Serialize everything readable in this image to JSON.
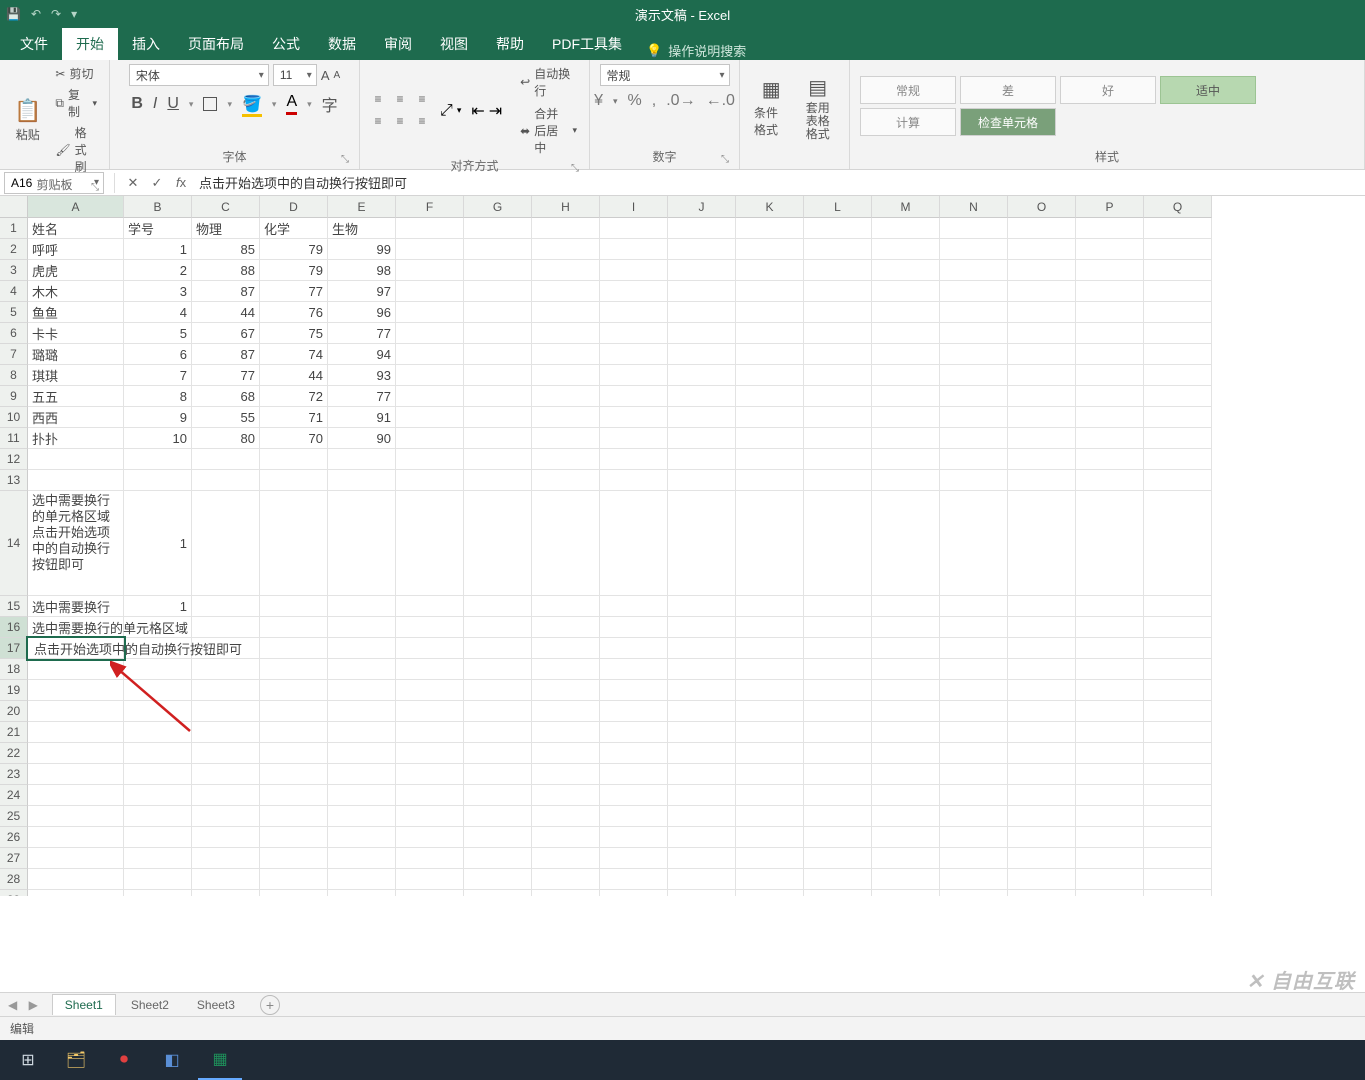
{
  "title": "演示文稿 - Excel",
  "qat": {
    "save": "💾",
    "undo": "↶",
    "redo": "↷",
    "more": "▾"
  },
  "tabs": [
    "文件",
    "开始",
    "插入",
    "页面布局",
    "公式",
    "数据",
    "审阅",
    "视图",
    "帮助",
    "PDF工具集"
  ],
  "active_tab": 1,
  "tell_me": "操作说明搜索",
  "clipboard": {
    "cut": "剪切",
    "copy": "复制",
    "brush": "格式刷",
    "paste": "粘贴",
    "label": "剪贴板"
  },
  "font": {
    "name": "宋体",
    "size": "11",
    "label": "字体",
    "bold": "B",
    "italic": "I",
    "underline": "U"
  },
  "align": {
    "wrap": "自动换行",
    "merge": "合并后居中",
    "label": "对齐方式"
  },
  "number": {
    "general": "常规",
    "label": "数字"
  },
  "cond": {
    "cond": "条件格式",
    "table": "套用\n表格格式"
  },
  "styles": {
    "label": "样式",
    "s1": "常规",
    "s2": "差",
    "s3": "好",
    "s4": "适中",
    "s5": "计算",
    "s6": "检查单元格"
  },
  "namebox": "A16",
  "formula": "点击开始选项中的自动换行按钮即可",
  "editing_value": "点击开始选项中的自动换行按钮即可",
  "cols": [
    "A",
    "B",
    "C",
    "D",
    "E",
    "F",
    "G",
    "H",
    "I",
    "J",
    "K",
    "L",
    "M",
    "N",
    "O",
    "P",
    "Q"
  ],
  "rows": {
    "header": [
      "姓名",
      "学号",
      "物理",
      "化学",
      "生物"
    ],
    "data": [
      [
        "呼呼",
        "1",
        "85",
        "79",
        "99"
      ],
      [
        "虎虎",
        "2",
        "88",
        "79",
        "98"
      ],
      [
        "木木",
        "3",
        "87",
        "77",
        "97"
      ],
      [
        "鱼鱼",
        "4",
        "44",
        "76",
        "96"
      ],
      [
        "卡卡",
        "5",
        "67",
        "75",
        "77"
      ],
      [
        "璐璐",
        "6",
        "87",
        "74",
        "94"
      ],
      [
        "琪琪",
        "7",
        "77",
        "44",
        "93"
      ],
      [
        "五五",
        "8",
        "68",
        "72",
        "77"
      ],
      [
        "西西",
        "9",
        "55",
        "71",
        "91"
      ],
      [
        "扑扑",
        "10",
        "80",
        "70",
        "90"
      ]
    ],
    "r14_a": "选中需要换行的单元格区域 点击开始选项中的自动换行按钮即可",
    "r14_b": "1",
    "r15_a": "选中需要换行",
    "r15_b": "1",
    "r16_a": "选中需要换行的单元格区域"
  },
  "vis_rows": 29,
  "sheet_tabs": [
    "Sheet1",
    "Sheet2",
    "Sheet3"
  ],
  "active_sheet": 0,
  "status": "编辑",
  "watermark": "✕ 自由互联"
}
